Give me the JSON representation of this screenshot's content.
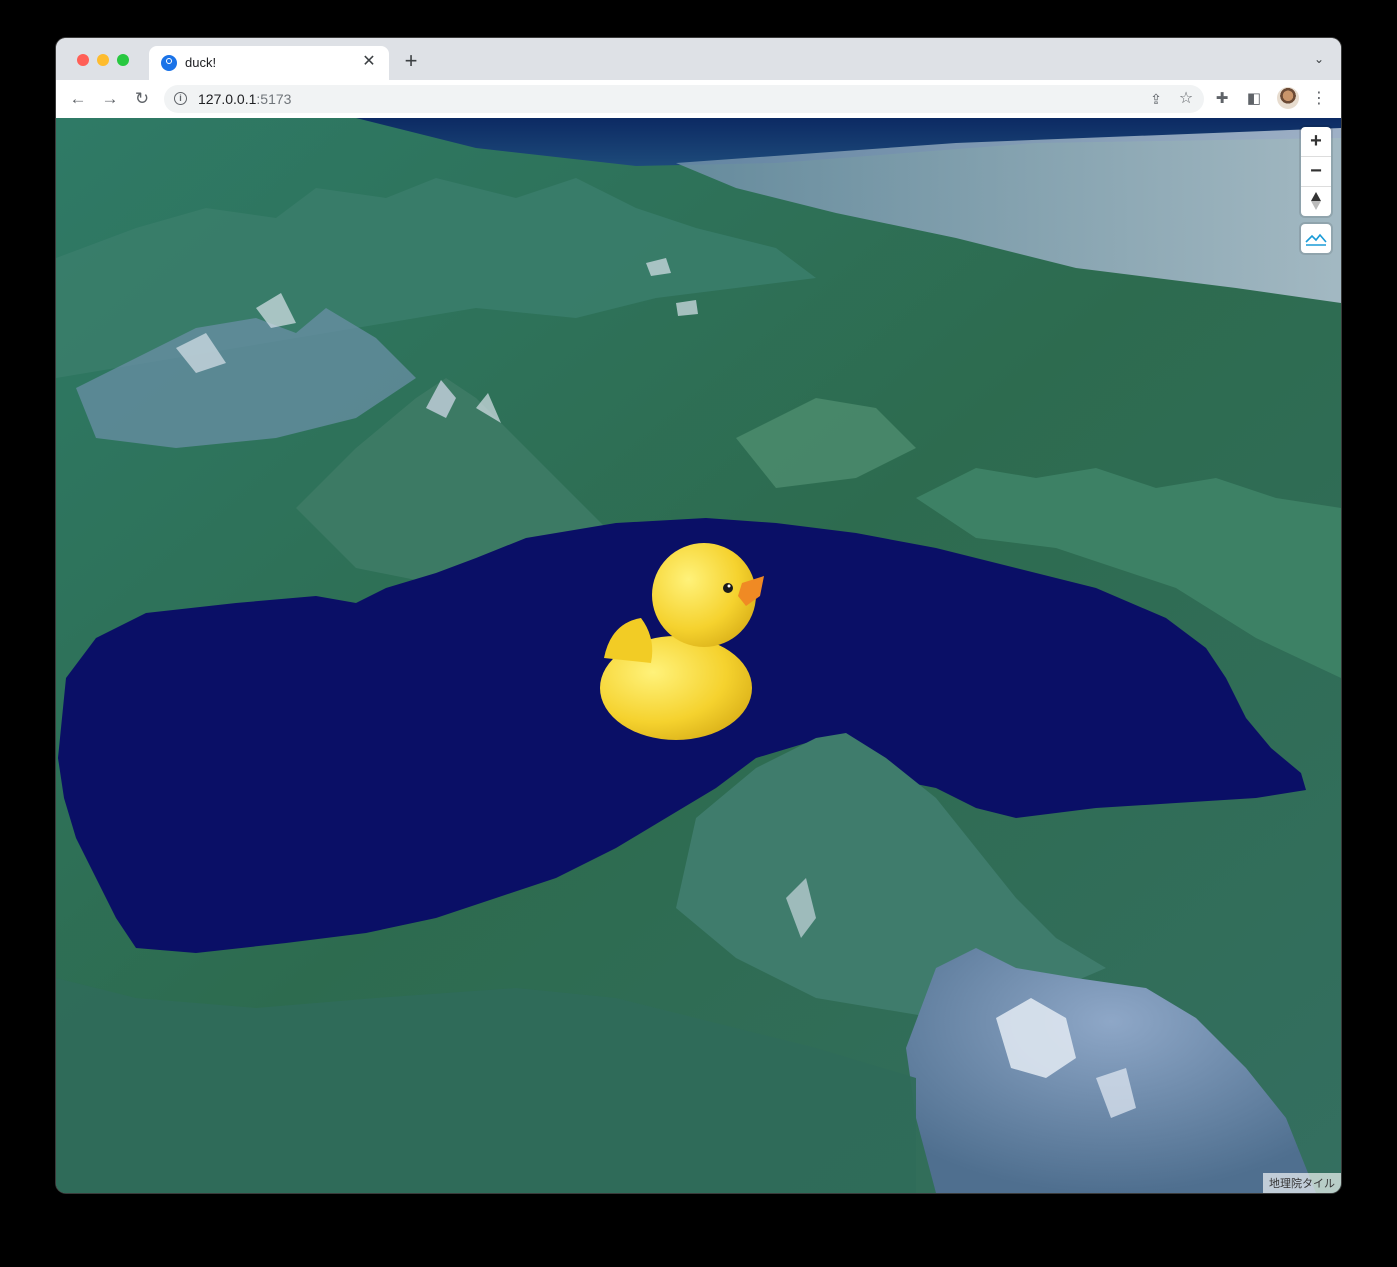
{
  "window": {
    "tab_title": "duck!",
    "tab_close_icon": "close-icon",
    "new_tab_icon": "plus-icon",
    "tab_menu_icon": "chevron-down-icon"
  },
  "toolbar": {
    "back_icon": "arrow-left-icon",
    "forward_icon": "arrow-right-icon",
    "reload_icon": "reload-icon",
    "url_host": "127.0.0.1",
    "url_port": ":5173",
    "share_icon": "share-icon",
    "bookmark_icon": "star-icon",
    "extensions_icon": "puzzle-icon",
    "sidepanel_icon": "side-panel-icon",
    "menu_icon": "kebab-menu-icon"
  },
  "map": {
    "controls": {
      "zoom_in": "+",
      "zoom_out": "−",
      "compass_icon": "compass-icon",
      "terrain_icon": "terrain-icon"
    },
    "attribution": "地理院タイル",
    "colors": {
      "lake": "#0a0f66",
      "forest": "#2e7a5c",
      "duck_body": "#f5d22e",
      "duck_beak": "#f08a24"
    }
  }
}
